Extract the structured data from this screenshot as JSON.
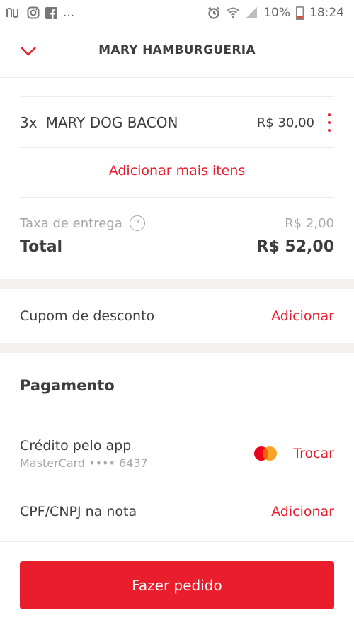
{
  "status_bar": {
    "left_ellipsis": "...",
    "battery": "10%",
    "time": "18:24",
    "icons": [
      "nubank-icon",
      "instagram-icon",
      "facebook-icon",
      "alarm-icon",
      "wifi-icon",
      "signal-icon",
      "battery-icon"
    ]
  },
  "header": {
    "title": "MARY HAMBURGUERIA",
    "back_icon": "chevron-down-icon"
  },
  "cart": {
    "items": [
      {
        "qty": "3x",
        "name": "MARY DOG BACON",
        "price": "R$ 30,00"
      }
    ],
    "add_more": "Adicionar mais itens"
  },
  "summary": {
    "fee_label": "Taxa de entrega",
    "fee_help": "?",
    "fee_value": "R$ 2,00",
    "total_label": "Total",
    "total_value": "R$ 52,00"
  },
  "coupon": {
    "label": "Cupom de desconto",
    "action": "Adicionar"
  },
  "payment": {
    "title": "Pagamento",
    "method_title": "Crédito pelo app",
    "method_sub": "MasterCard •••• 6437",
    "change": "Trocar",
    "card_brand_icon": "mastercard-icon"
  },
  "cpf": {
    "label": "CPF/CNPJ na nota",
    "action": "Adicionar"
  },
  "cta": {
    "label": "Fazer pedido"
  },
  "colors": {
    "accent": "#ea1d2c",
    "text": "#3e3e3e",
    "muted": "#a6a6a6",
    "divider": "#ececec",
    "band": "#f3f0ed"
  }
}
